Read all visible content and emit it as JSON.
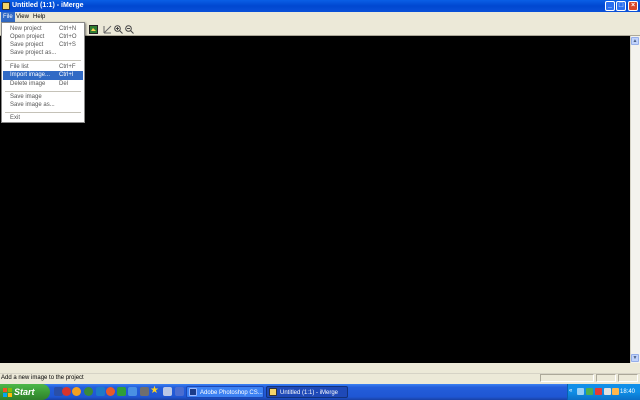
{
  "window": {
    "title": "Untitled (1:1) - iMerge"
  },
  "menubar": {
    "file": "File",
    "view": "View",
    "help": "Help"
  },
  "file_menu": {
    "items": [
      {
        "label": "New project",
        "shortcut": "Ctrl+N"
      },
      {
        "label": "Open project",
        "shortcut": "Ctrl+O"
      },
      {
        "label": "Save project",
        "shortcut": "Ctrl+S"
      },
      {
        "label": "Save project as...",
        "shortcut": ""
      },
      {
        "label": "File list",
        "shortcut": "Ctrl+F"
      },
      {
        "label": "Import image...",
        "shortcut": "Ctrl+I"
      },
      {
        "label": "Delete image",
        "shortcut": "Del"
      },
      {
        "label": "Save image",
        "shortcut": ""
      },
      {
        "label": "Save image as...",
        "shortcut": ""
      },
      {
        "label": "Exit",
        "shortcut": ""
      }
    ],
    "highlighted": "Import image..."
  },
  "status": {
    "text": "Add a new image to the project"
  },
  "taskbar": {
    "start": "Start",
    "tasks": [
      {
        "label": "Adobe Photoshop CS..."
      },
      {
        "label": "Untitled (1:1) - iMerge"
      }
    ],
    "clock": "18:40"
  },
  "colors": {
    "accent": "#316ac5",
    "canvas": "#000000",
    "titlebar": "#0054e3",
    "start": "#3c9c37"
  }
}
